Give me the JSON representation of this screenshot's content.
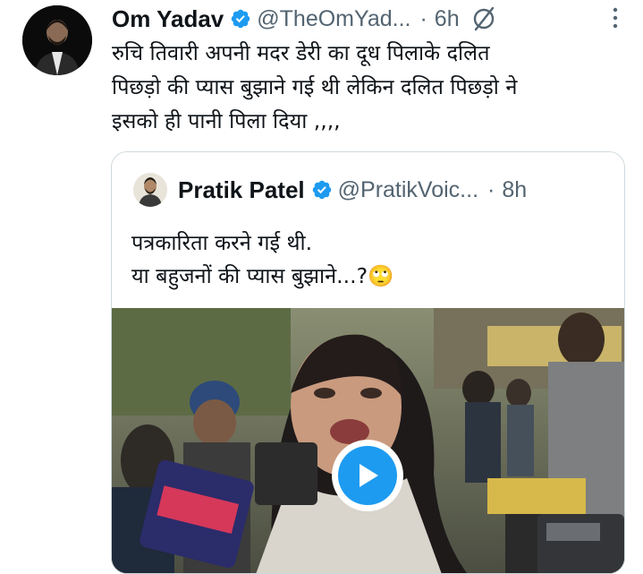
{
  "tweet": {
    "author_name": "Om Yadav",
    "handle": "@TheOmYad...",
    "separator": "·",
    "time": "6h",
    "text_lines": [
      "रुचि तिवारी अपनी मदर डेरी का दूध पिलाके दलित",
      "पिछड़ो  की प्यास बुझाने गई थी लेकिन दलित पिछड़ो ने",
      "इसको ही पानी पिला दिया ,,,,"
    ]
  },
  "quote": {
    "author_name": "Pratik Patel",
    "handle": "@PratikVoic...",
    "separator": "·",
    "time": "8h",
    "text_lines": [
      "पत्रकारिता करने गई थी.",
      "या बहुजनों की प्यास बुझाने...?"
    ],
    "emoji": "🙄"
  },
  "colors": {
    "verified_blue": "#1d9bf0",
    "text_primary": "#0f1419",
    "text_secondary": "#536471",
    "border": "#cfd9de",
    "play_button": "#1d9bf0"
  },
  "icons": [
    "verified-badge-icon",
    "grok-icon",
    "more-options-icon",
    "play-icon"
  ]
}
